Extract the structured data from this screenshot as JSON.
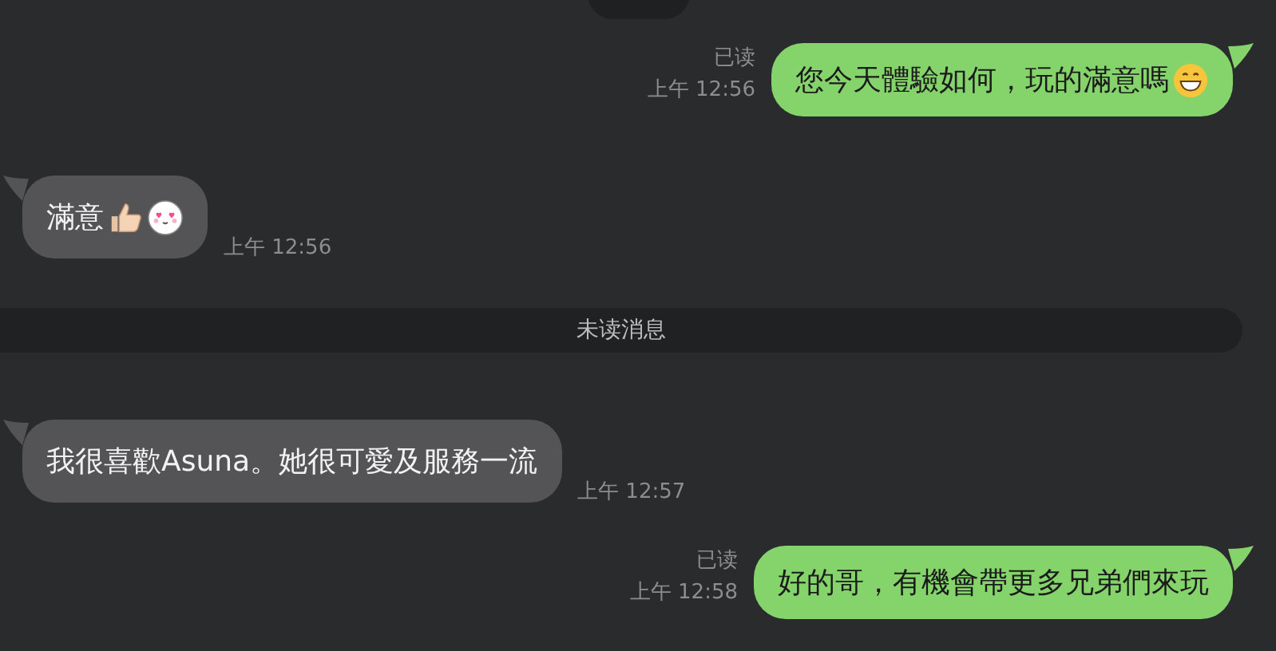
{
  "messages": [
    {
      "kind": "date"
    },
    {
      "kind": "out",
      "text": "您今天體驗如何，玩的滿意嗎",
      "emojis": [
        {
          "kind": "grin"
        }
      ],
      "receipt": "已读",
      "time": "上午 12:56"
    },
    {
      "kind": "in",
      "text": "滿意",
      "emojis": [
        {
          "kind": "thumbs-up"
        },
        {
          "kind": "heart-eyes"
        }
      ],
      "time": "上午 12:56"
    },
    {
      "kind": "unread",
      "text": "未读消息"
    },
    {
      "kind": "in",
      "text": "我很喜歡Asuna。她很可愛及服務一流",
      "time": "上午 12:57"
    },
    {
      "kind": "out",
      "text": "好的哥，有機會帶更多兄弟們來玩",
      "receipt": "已读",
      "time": "上午 12:58"
    }
  ]
}
